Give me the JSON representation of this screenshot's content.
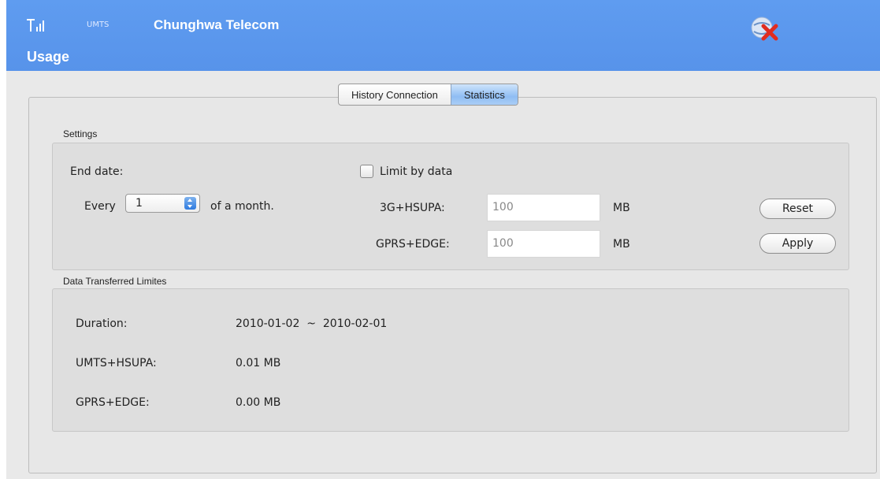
{
  "header": {
    "signal_label": "T.ıll",
    "network_type": "UMTS",
    "carrier": "Chunghwa Telecom",
    "title": "Usage"
  },
  "tabs": [
    {
      "label": "History Connection",
      "active": false
    },
    {
      "label": "Statistics",
      "active": true
    }
  ],
  "settings": {
    "group_label": "Settings",
    "end_date_label": "End date:",
    "every_label": "Every",
    "day_value": "1",
    "of_month_label": "of a month.",
    "limit_label": "Limit by data",
    "limit_checked": false,
    "hsupa_label": "3G+HSUPA:",
    "hsupa_value": "100",
    "hsupa_unit": "MB",
    "gprs_label": "GPRS+EDGE:",
    "gprs_value": "100",
    "gprs_unit": "MB",
    "reset_label": "Reset",
    "apply_label": "Apply"
  },
  "transferred": {
    "group_label": "Data Transferred  Limites",
    "duration_label": "Duration:",
    "duration_value": "2010-01-02  ~  2010-02-01",
    "umts_label": "UMTS+HSUPA:",
    "umts_value": "0.01 MB",
    "gprs_label": "GPRS+EDGE:",
    "gprs_value": "0.00 MB"
  },
  "colors": {
    "header_blue": "#5b98ed",
    "active_tab": "#8fbdf3"
  },
  "icons": [
    "signal-icon",
    "disconnect-icon",
    "stepper-icon",
    "checkbox-icon"
  ]
}
